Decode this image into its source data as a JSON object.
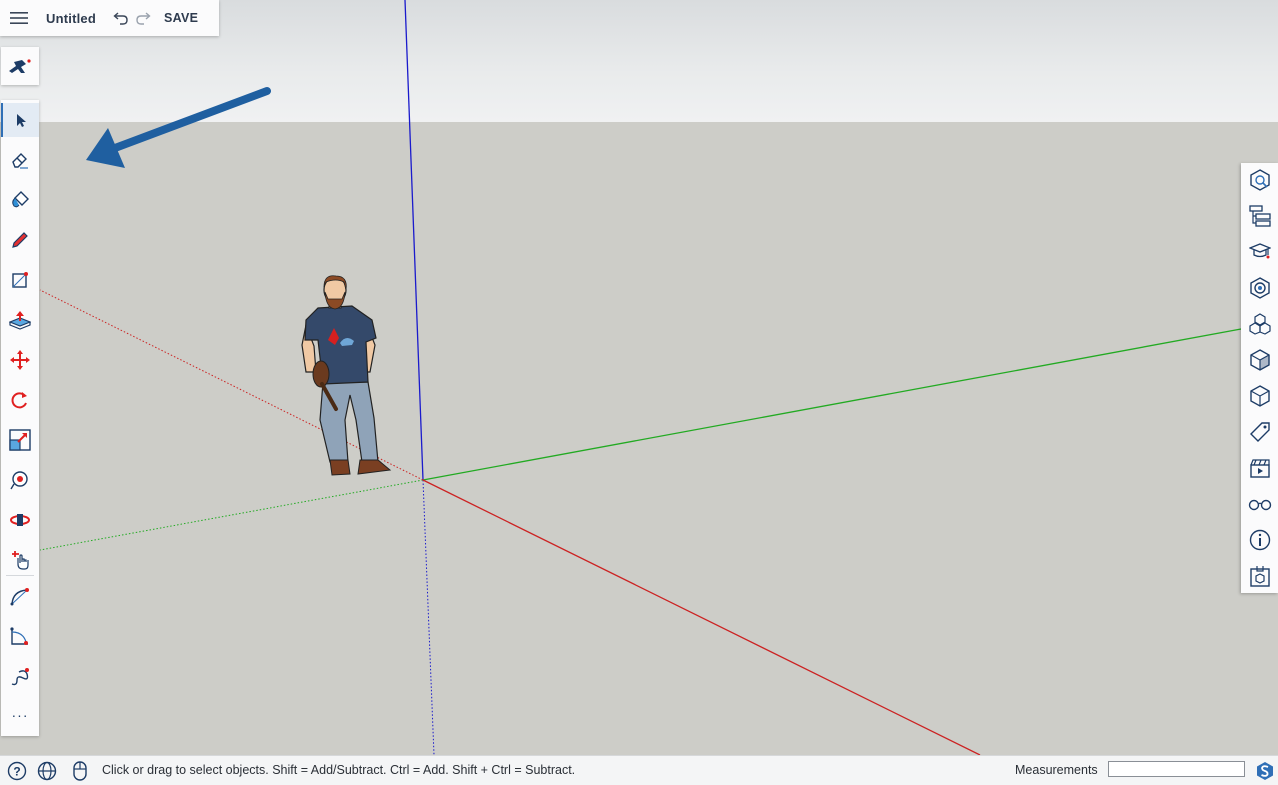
{
  "app": {
    "document_title": "Untitled",
    "save_label": "SAVE"
  },
  "icons": {
    "menu": "hamburger-menu-icon",
    "undo": "undo-icon",
    "redo": "redo-icon",
    "logo": "sketchup-logo-icon"
  },
  "left_toolbar": {
    "tools": [
      {
        "name": "select-tool",
        "icon": "arrow-cursor-icon",
        "active": true
      },
      {
        "name": "eraser-tool",
        "icon": "eraser-icon"
      },
      {
        "name": "paint-bucket-tool",
        "icon": "paint-bucket-icon"
      },
      {
        "name": "pencil-tool",
        "icon": "pencil-icon"
      },
      {
        "name": "rectangle-tool",
        "icon": "rectangle-icon"
      },
      {
        "name": "push-pull-tool",
        "icon": "push-pull-icon"
      },
      {
        "name": "move-tool",
        "icon": "move-arrows-icon"
      },
      {
        "name": "rotate-tool",
        "icon": "rotate-icon"
      },
      {
        "name": "scale-tool",
        "icon": "scale-icon"
      },
      {
        "name": "tape-measure-tool",
        "icon": "tape-measure-icon"
      },
      {
        "name": "orbit-tool",
        "icon": "orbit-icon"
      },
      {
        "name": "pan-tool",
        "icon": "hand-pan-icon"
      },
      {
        "name": "arc-tool",
        "icon": "arc-icon"
      },
      {
        "name": "follow-me-tool",
        "icon": "follow-me-icon"
      },
      {
        "name": "freehand-tool",
        "icon": "freehand-icon"
      },
      {
        "name": "more-tools",
        "icon": "more-dots-icon"
      }
    ],
    "more_label": "···"
  },
  "right_panel": {
    "items": [
      {
        "name": "entity-info-panel",
        "icon": "entity-info-icon"
      },
      {
        "name": "outliner-panel",
        "icon": "outliner-icon"
      },
      {
        "name": "instructor-panel",
        "icon": "instructor-icon"
      },
      {
        "name": "materials-panel",
        "icon": "materials-icon"
      },
      {
        "name": "components-panel",
        "icon": "components-icon"
      },
      {
        "name": "styles-panel",
        "icon": "styles-icon"
      },
      {
        "name": "views-panel",
        "icon": "views-icon"
      },
      {
        "name": "tags-panel",
        "icon": "tag-icon"
      },
      {
        "name": "scenes-panel",
        "icon": "scenes-icon"
      },
      {
        "name": "display-panel",
        "icon": "glasses-icon"
      },
      {
        "name": "model-info-panel",
        "icon": "info-icon"
      },
      {
        "name": "3d-warehouse-panel",
        "icon": "warehouse-icon"
      }
    ]
  },
  "statusbar": {
    "help_icon": "help-icon",
    "globe_icon": "globe-icon",
    "mouse_icon": "mouse-icon",
    "hint": "Click or drag to select objects. Shift = Add/Subtract. Ctrl = Add. Shift + Ctrl = Subtract.",
    "measurements_label": "Measurements",
    "measurements_value": "",
    "brand_icon": "sketchup-s-icon"
  },
  "colors": {
    "accent": "#2f6fb6",
    "axis_blue": "#1a1acc",
    "axis_green": "#22aa22",
    "axis_red": "#cc2222",
    "annotation_arrow": "#1f5fa0"
  }
}
